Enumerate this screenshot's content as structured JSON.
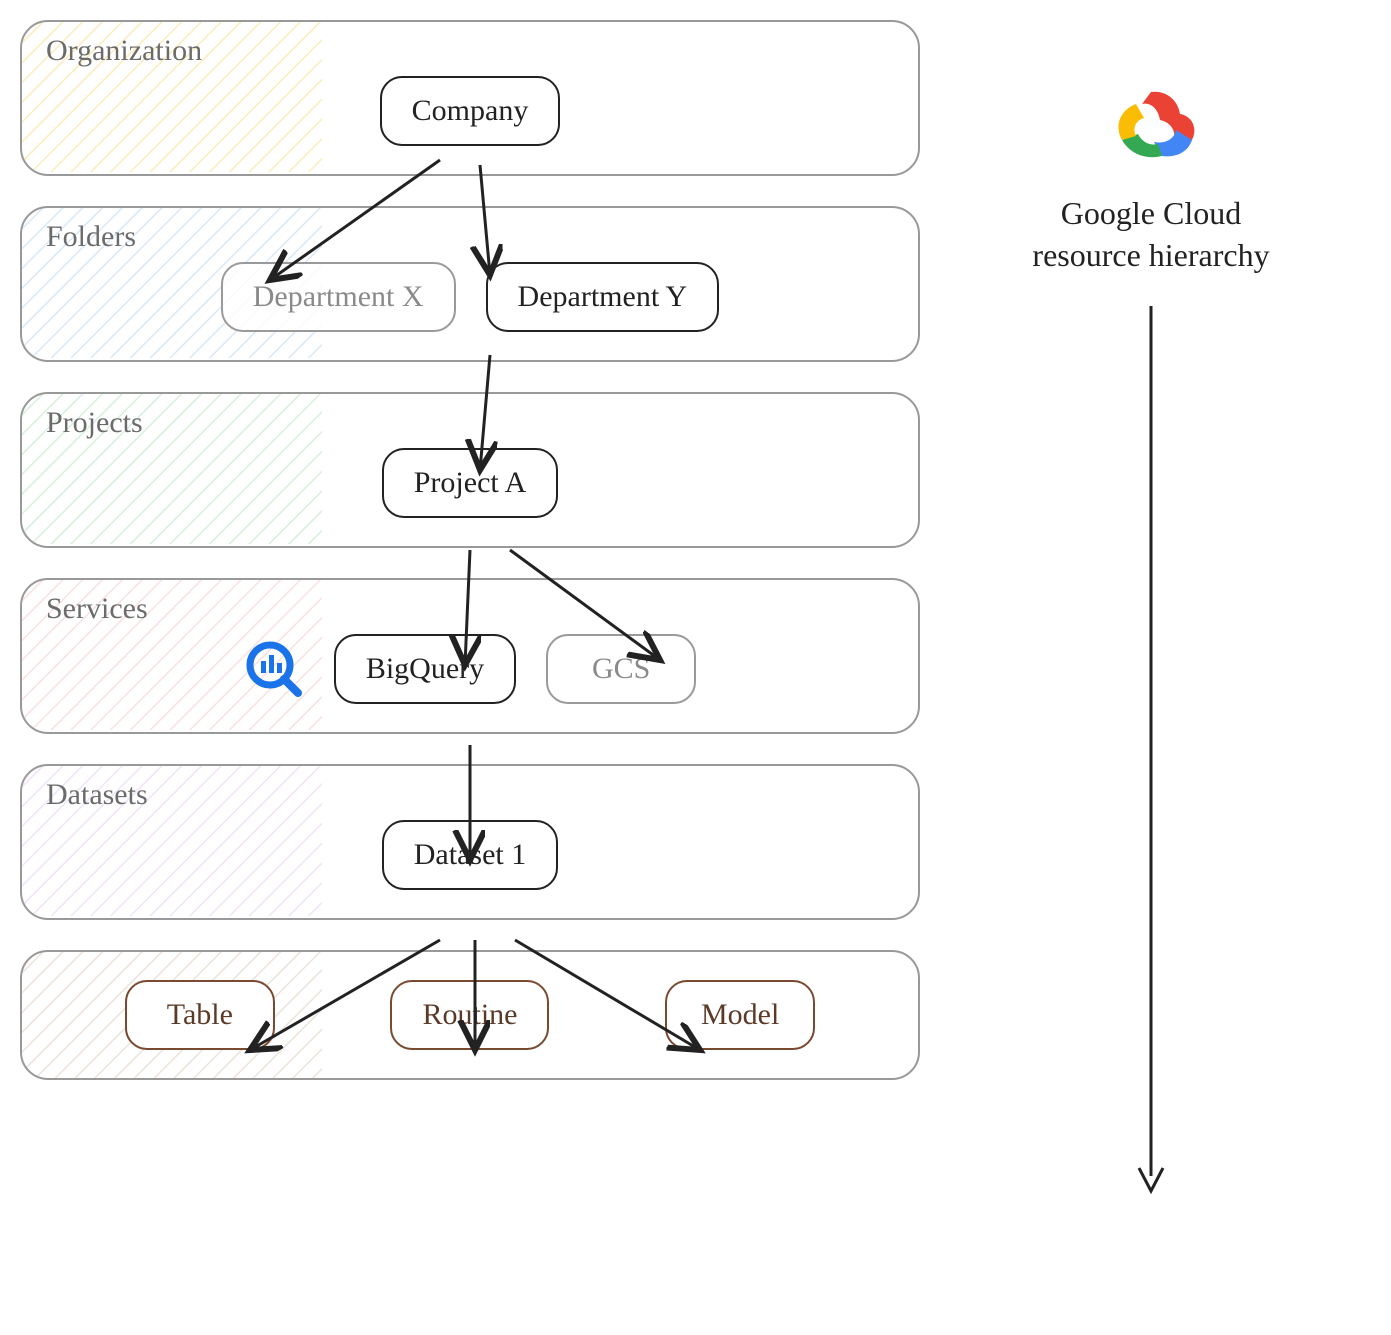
{
  "sidebar": {
    "title_line1": "Google Cloud",
    "title_line2": "resource hierarchy",
    "icon": "google-cloud-logo"
  },
  "tiers": {
    "organization": {
      "label": "Organization",
      "color": "#f4cc3a"
    },
    "folders": {
      "label": "Folders",
      "color": "#8fbfe8"
    },
    "projects": {
      "label": "Projects",
      "color": "#8fd49a"
    },
    "services": {
      "label": "Services",
      "color": "#f0a8a8"
    },
    "datasets": {
      "label": "Datasets",
      "color": "#d4b3e8"
    },
    "leaf": {
      "label": "",
      "color": "#c9b098"
    }
  },
  "nodes": {
    "company": {
      "label": "Company"
    },
    "dept_x": {
      "label": "Department X"
    },
    "dept_y": {
      "label": "Department Y"
    },
    "project_a": {
      "label": "Project A"
    },
    "bigquery": {
      "label": "BigQuery",
      "icon": "bigquery-icon"
    },
    "gcs": {
      "label": "GCS"
    },
    "dataset1": {
      "label": "Dataset 1"
    },
    "table": {
      "label": "Table"
    },
    "routine": {
      "label": "Routine"
    },
    "model": {
      "label": "Model"
    }
  },
  "edges": [
    [
      "company",
      "dept_x"
    ],
    [
      "company",
      "dept_y"
    ],
    [
      "dept_y",
      "project_a"
    ],
    [
      "project_a",
      "bigquery"
    ],
    [
      "project_a",
      "gcs"
    ],
    [
      "bigquery",
      "dataset1"
    ],
    [
      "dataset1",
      "table"
    ],
    [
      "dataset1",
      "routine"
    ],
    [
      "dataset1",
      "model"
    ]
  ]
}
